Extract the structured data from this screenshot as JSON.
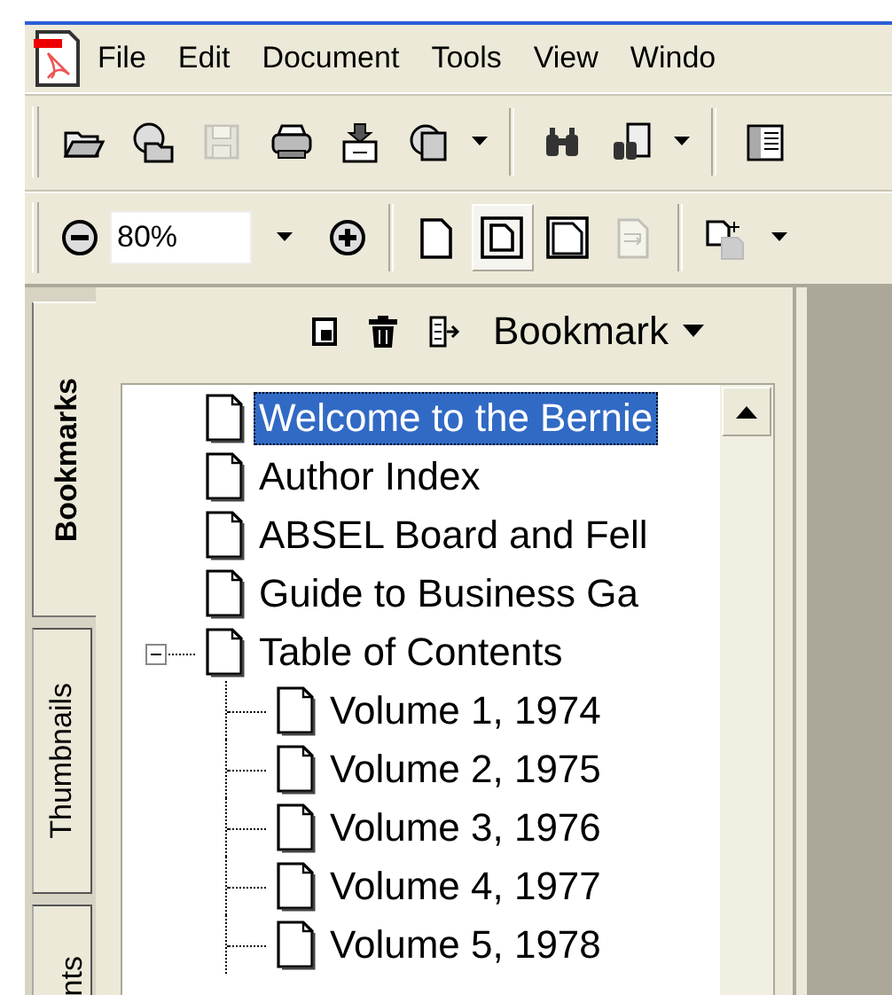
{
  "menu_bar": {
    "items": [
      {
        "label": "File"
      },
      {
        "label": "Edit"
      },
      {
        "label": "Document"
      },
      {
        "label": "Tools"
      },
      {
        "label": "View"
      },
      {
        "label": "Windo"
      }
    ]
  },
  "file_toolbar": {
    "buttons": [
      {
        "kind": "open",
        "disabled": false
      },
      {
        "kind": "web",
        "disabled": false
      },
      {
        "kind": "save",
        "disabled": true
      },
      {
        "kind": "print",
        "disabled": false
      },
      {
        "kind": "email",
        "disabled": false
      },
      {
        "kind": "share",
        "disabled": false,
        "dropdown": true
      },
      {
        "kind": "find",
        "disabled": false
      },
      {
        "kind": "search",
        "disabled": false,
        "dropdown": true
      },
      {
        "kind": "panel",
        "disabled": false
      }
    ]
  },
  "zoom_toolbar": {
    "zoom_value": "80%",
    "view_buttons": [
      {
        "kind": "single",
        "selected": false,
        "disabled": false
      },
      {
        "kind": "fit",
        "selected": true,
        "disabled": false
      },
      {
        "kind": "width",
        "selected": false,
        "disabled": false
      },
      {
        "kind": "reflow",
        "selected": false,
        "disabled": true
      }
    ]
  },
  "side_tabs": [
    {
      "label": "Bookmarks",
      "selected": true
    },
    {
      "label": "Thumbnails",
      "selected": false
    },
    {
      "label": "nts",
      "selected": false
    }
  ],
  "bookmarks_panel": {
    "options_label": "Bookmark",
    "tree": [
      {
        "label": "Welcome to the Bernie",
        "selected": true
      },
      {
        "label": "Author Index",
        "selected": false
      },
      {
        "label": "ABSEL Board and Fell",
        "selected": false
      },
      {
        "label": "Guide to Business Ga",
        "selected": false
      },
      {
        "label": "Table of Contents",
        "selected": false,
        "expanded": true,
        "children": [
          {
            "label": "Volume 1, 1974",
            "selected": false
          },
          {
            "label": "Volume 2, 1975",
            "selected": false
          },
          {
            "label": "Volume 3, 1976",
            "selected": false
          },
          {
            "label": "Volume 4, 1977",
            "selected": false
          },
          {
            "label": "Volume 5, 1978",
            "selected": false
          }
        ]
      }
    ]
  }
}
